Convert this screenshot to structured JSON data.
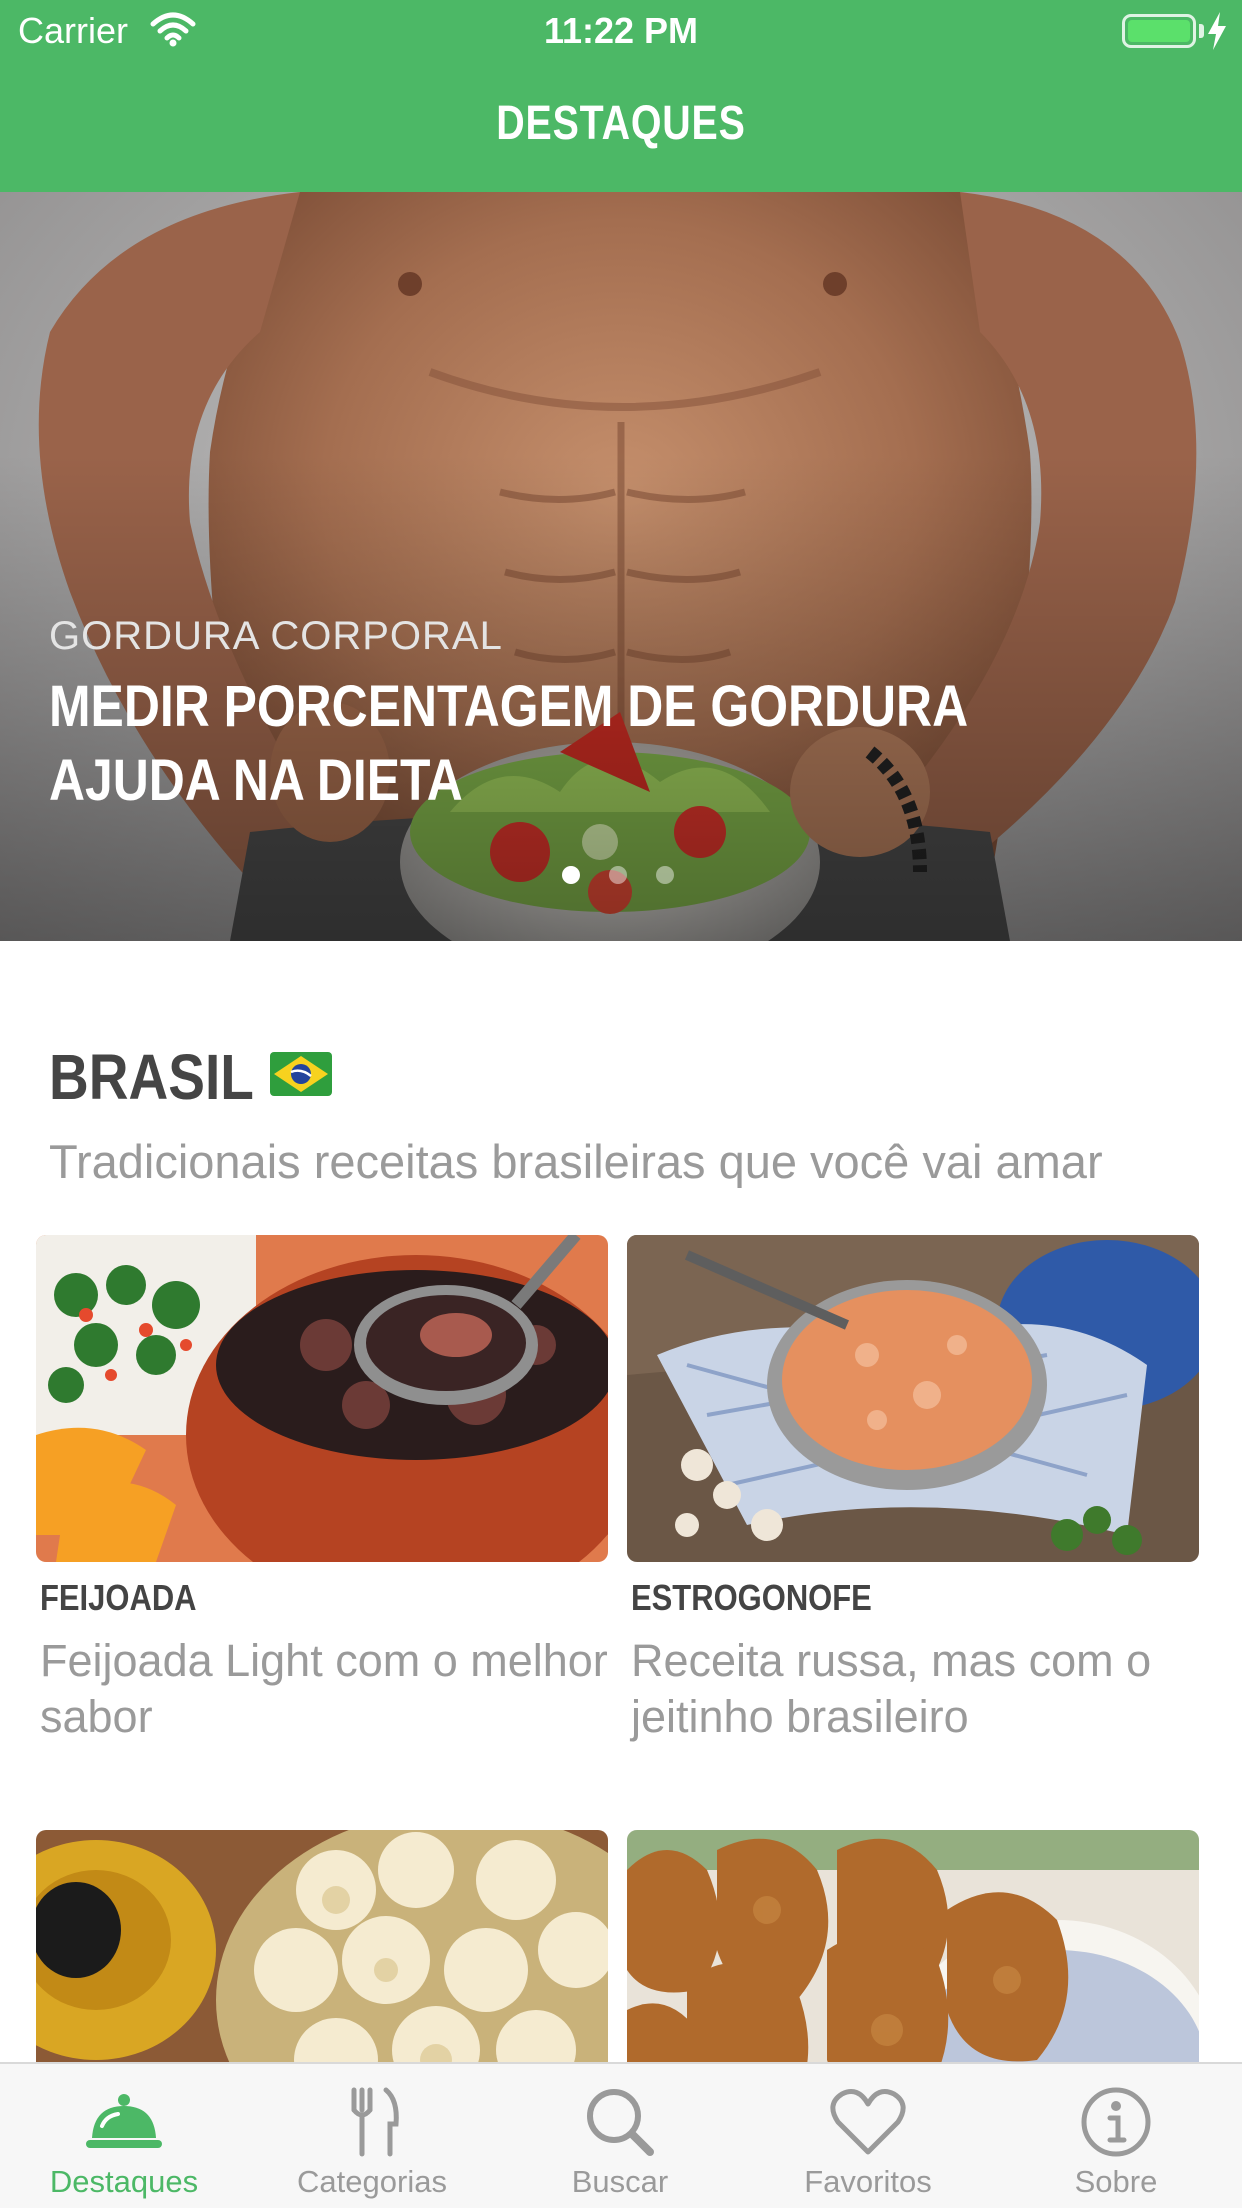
{
  "status_bar": {
    "carrier": "Carrier",
    "time": "11:22 PM"
  },
  "nav": {
    "title": "DESTAQUES"
  },
  "hero": {
    "kicker": "GORDURA CORPORAL",
    "headline": "MEDIR PORCENTAGEM DE GORDURA AJUDA NA DIETA",
    "page_count": 3,
    "active_page": 1
  },
  "section": {
    "title": "BRASIL",
    "subtitle": "Tradicionais receitas brasileiras que você vai amar"
  },
  "cards": [
    {
      "name": "FEIJOADA",
      "description": "Feijoada Light com o melhor sabor"
    },
    {
      "name": "ESTROGONOFE",
      "description": "Receita russa, mas com o jeitinho brasileiro"
    },
    {
      "name": "",
      "description": ""
    },
    {
      "name": "",
      "description": ""
    }
  ],
  "tabs": [
    {
      "label": "Destaques",
      "icon": "cloche-icon",
      "active": true
    },
    {
      "label": "Categorias",
      "icon": "fork-knife-icon",
      "active": false
    },
    {
      "label": "Buscar",
      "icon": "search-icon",
      "active": false
    },
    {
      "label": "Favoritos",
      "icon": "heart-icon",
      "active": false
    },
    {
      "label": "Sobre",
      "icon": "info-icon",
      "active": false
    }
  ],
  "colors": {
    "brand_green": "#4cb866",
    "tab_inactive": "#9a9a9a"
  }
}
